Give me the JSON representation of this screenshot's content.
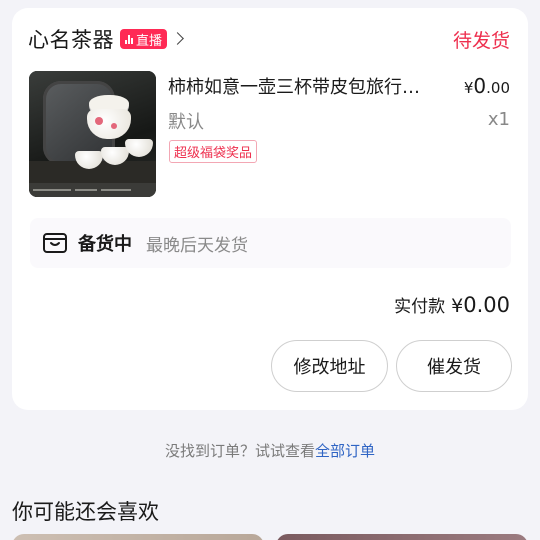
{
  "order": {
    "shop_name": "心名茶器",
    "live_badge": "直播",
    "status": "待发货",
    "product": {
      "title": "柿柿如意一壶三杯带皮包旅行茶具",
      "variant": "默认",
      "price_symbol": "¥",
      "price_int": "0",
      "price_dec": ".00",
      "quantity": "x1",
      "promo_tag": "超级福袋奖品"
    },
    "shipping": {
      "status": "备货中",
      "description": "最晚后天发货"
    },
    "paid": {
      "label": "实付款",
      "symbol": "¥",
      "amount": "0.00"
    },
    "buttons": {
      "modify_address": "修改地址",
      "urge_shipping": "催发货"
    }
  },
  "not_found": {
    "prefix": "没找到订单？试试查看",
    "link": "全部订单"
  },
  "recommend": {
    "title": "你可能还会喜欢"
  },
  "colors": {
    "accent_red": "#ee2f4e",
    "live_badge": "#ff2a55",
    "link_blue": "#2f64c4"
  }
}
